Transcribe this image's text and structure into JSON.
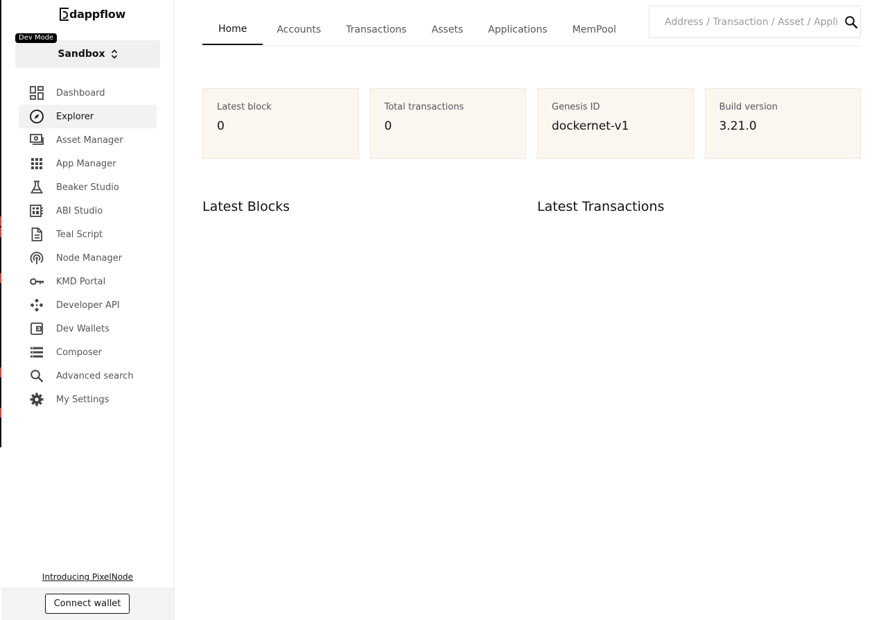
{
  "app": {
    "logo": "dappflow",
    "dev_mode_badge": "Dev Mode",
    "network": "Sandbox"
  },
  "sidebar": {
    "items": [
      {
        "label": "Dashboard",
        "icon": "dashboard-icon"
      },
      {
        "label": "Explorer",
        "icon": "compass-icon",
        "active": true
      },
      {
        "label": "Asset Manager",
        "icon": "asset-icon"
      },
      {
        "label": "App Manager",
        "icon": "apps-grid-icon"
      },
      {
        "label": "Beaker Studio",
        "icon": "flask-icon"
      },
      {
        "label": "ABI Studio",
        "icon": "abi-icon"
      },
      {
        "label": "Teal Script",
        "icon": "document-icon"
      },
      {
        "label": "Node Manager",
        "icon": "node-icon"
      },
      {
        "label": "KMD Portal",
        "icon": "key-icon"
      },
      {
        "label": "Developer API",
        "icon": "api-icon"
      },
      {
        "label": "Dev Wallets",
        "icon": "wallet-icon"
      },
      {
        "label": "Composer",
        "icon": "list-icon"
      },
      {
        "label": "Advanced search",
        "icon": "search-icon"
      },
      {
        "label": "My Settings",
        "icon": "gear-icon"
      }
    ],
    "intro_link": "Introducing PixelNode",
    "connect_wallet": "Connect wallet"
  },
  "tabs": [
    {
      "label": "Home",
      "active": true
    },
    {
      "label": "Accounts"
    },
    {
      "label": "Transactions"
    },
    {
      "label": "Assets"
    },
    {
      "label": "Applications"
    },
    {
      "label": "MemPool"
    }
  ],
  "search": {
    "placeholder": "Address / Transaction / Asset / Application",
    "value": ""
  },
  "stats": [
    {
      "label": "Latest block",
      "value": "0"
    },
    {
      "label": "Total transactions",
      "value": "0"
    },
    {
      "label": "Genesis ID",
      "value": "dockernet-v1"
    },
    {
      "label": "Build version",
      "value": "3.21.0"
    }
  ],
  "sections": {
    "latest_blocks": "Latest Blocks",
    "latest_transactions": "Latest Transactions"
  },
  "colors": {
    "card_bg": "#fcf6f1",
    "active_tab": "#111111",
    "accent_marks": "#e0483a"
  }
}
